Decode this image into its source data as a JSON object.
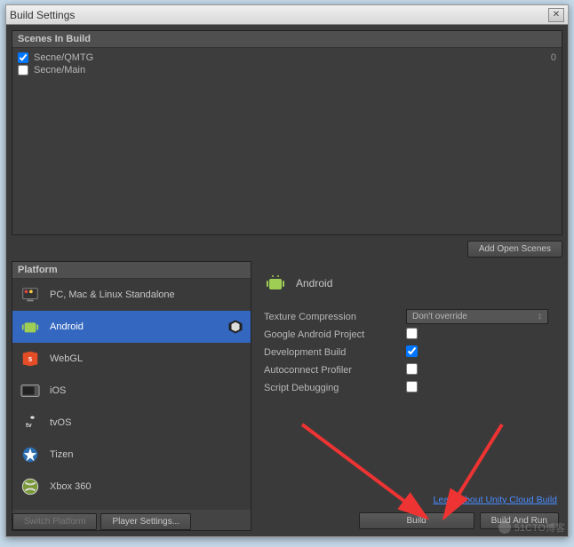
{
  "window": {
    "title": "Build Settings"
  },
  "scenes": {
    "header": "Scenes In Build",
    "items": [
      {
        "checked": true,
        "path": "Secne/QMTG",
        "index": "0"
      },
      {
        "checked": false,
        "path": "Secne/Main",
        "index": ""
      }
    ],
    "add_button": "Add Open Scenes"
  },
  "platform": {
    "header": "Platform",
    "items": [
      {
        "id": "standalone",
        "label": "PC, Mac & Linux Standalone",
        "selected": false
      },
      {
        "id": "android",
        "label": "Android",
        "selected": true
      },
      {
        "id": "webgl",
        "label": "WebGL",
        "selected": false
      },
      {
        "id": "ios",
        "label": "iOS",
        "selected": false
      },
      {
        "id": "tvos",
        "label": "tvOS",
        "selected": false
      },
      {
        "id": "tizen",
        "label": "Tizen",
        "selected": false
      },
      {
        "id": "xbox360",
        "label": "Xbox 360",
        "selected": false
      }
    ],
    "switch_label": "Switch Platform",
    "player_settings_label": "Player Settings..."
  },
  "details": {
    "selected_name": "Android",
    "options": {
      "texture_compression_label": "Texture Compression",
      "texture_compression_value": "Don't override",
      "google_project_label": "Google Android Project",
      "google_project_checked": false,
      "dev_build_label": "Development Build",
      "dev_build_checked": true,
      "autoconnect_label": "Autoconnect Profiler",
      "autoconnect_checked": false,
      "script_debug_label": "Script Debugging",
      "script_debug_checked": false
    },
    "cloud_link": "Learn about Unity Cloud Build",
    "build_label": "Build",
    "build_run_label": "Build And Run"
  },
  "watermark": "51CTO博客"
}
